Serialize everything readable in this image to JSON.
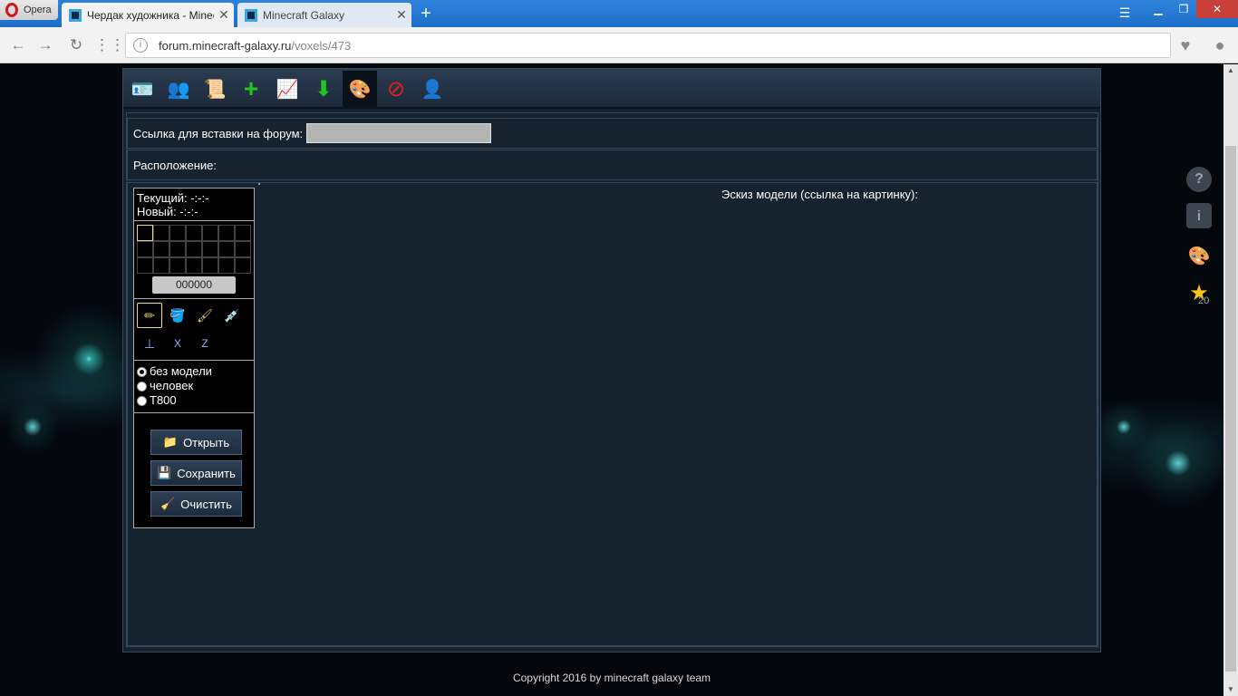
{
  "browser": {
    "menu_label": "Opera",
    "tabs": [
      {
        "title": "Чердак художника - Minecra",
        "close": "✕"
      },
      {
        "title": "Minecraft Galaxy",
        "close": "✕"
      }
    ],
    "new_tab": "+",
    "url_domain": "forum.minecraft-galaxy.ru",
    "url_path": "/voxels/473",
    "window_buttons": {
      "minimize": "▁",
      "maximize": "❐",
      "close": "✕"
    }
  },
  "toolbar": {
    "icons": [
      "profile-card-icon",
      "friends-icon",
      "scroll-icon",
      "add-icon",
      "stats-chart-icon",
      "download-icon",
      "palette-icon",
      "block-icon",
      "user-icon"
    ],
    "active_index": 6
  },
  "form": {
    "link_label": "Ссылка для вставки на форум:",
    "link_value": "",
    "location_label": "Расположение:"
  },
  "editor": {
    "current_label": "Текущий: -:-:-",
    "new_label": "Новый: -:-:-",
    "hex_value": "000000",
    "sketch_label": "Эскиз модели (ссылка на картинку):",
    "tools": [
      "pencil-icon",
      "fill-bucket-icon",
      "brush-icon",
      "eyedropper-icon",
      "axis-y-icon",
      "axis-x-icon",
      "axis-z-icon"
    ],
    "tool_glyphs": {
      "axis_y": "⊥",
      "axis_x": "X",
      "axis_z": "Z"
    },
    "models": [
      {
        "label": "без модели",
        "selected": true
      },
      {
        "label": "человек",
        "selected": false
      },
      {
        "label": "T800",
        "selected": false
      }
    ],
    "buttons": {
      "open": "Открыть",
      "save": "Сохранить",
      "clear": "Очистить"
    }
  },
  "sidebar": {
    "help": "?",
    "info": "i",
    "star_count": "20"
  },
  "footer": "Copyright 2016 by minecraft galaxy team",
  "colors": {
    "page_bg": "#17222f",
    "border": "#34495e",
    "tab_bar": "#2f82dc",
    "selected_outline": "#e8e07a"
  }
}
